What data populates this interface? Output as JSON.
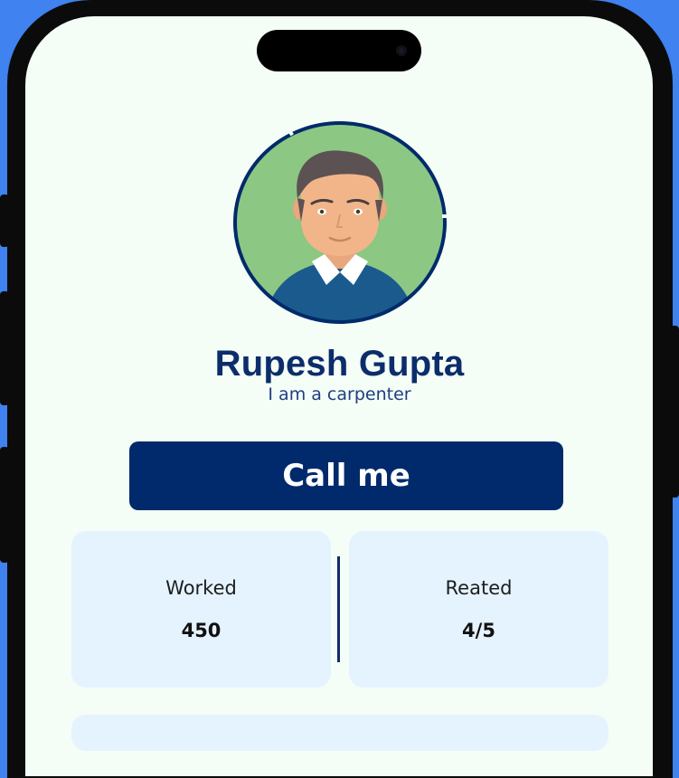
{
  "profile": {
    "name": "Rupesh Gupta",
    "tagline": "I am a carpenter",
    "avatar_icon": "person-avatar-icon"
  },
  "actions": {
    "call_label": "Call me"
  },
  "stats": [
    {
      "label": "Worked",
      "value": "450"
    },
    {
      "label": "Reated",
      "value": "4/5"
    }
  ],
  "colors": {
    "background": "#3f82f0",
    "screen": "#f4fdf6",
    "primary": "#002a6b",
    "heading": "#0c2d6b",
    "card": "#e5f3ff",
    "avatar_bg": "#8cc784"
  }
}
